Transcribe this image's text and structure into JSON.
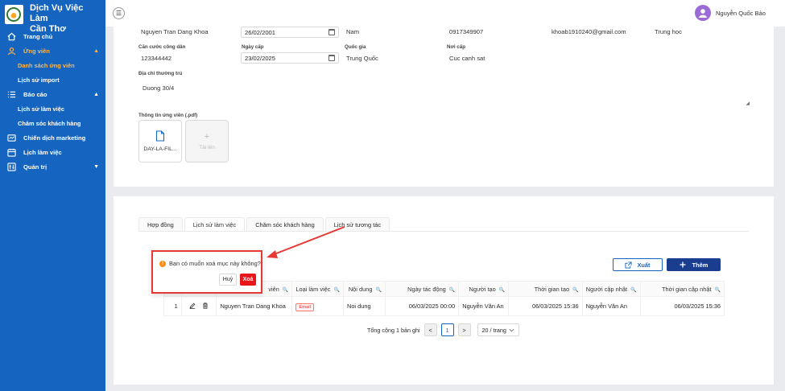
{
  "brand": {
    "title_line1": "Dịch Vụ Việc Làm",
    "title_line2": "Cần Thơ"
  },
  "sidebar": {
    "items": [
      {
        "label": "Trang chủ",
        "icon": "home-icon"
      },
      {
        "label": "Ứng viên",
        "icon": "user-icon",
        "caret": "▲"
      },
      {
        "label": "Danh sách ứng viên"
      },
      {
        "label": "Lịch sử import"
      },
      {
        "label": "Báo cáo",
        "icon": "list-icon",
        "caret": "▲"
      },
      {
        "label": "Lịch sử làm việc"
      },
      {
        "label": "Chăm sóc khách hàng"
      },
      {
        "label": "Chiến dịch marketing",
        "icon": "campaign-icon"
      },
      {
        "label": "Lịch làm việc",
        "icon": "calendar-icon"
      },
      {
        "label": "Quản trị",
        "icon": "admin-icon",
        "caret": "▼"
      }
    ]
  },
  "topbar": {
    "menu_toggle": "☰",
    "user_name": "Nguyễn Quốc Bảo"
  },
  "profile": {
    "full_name": "Nguyen Tran Dang Khoa",
    "dob": "26/02/2001",
    "gender": "Nam",
    "phone": "0917349907",
    "email": "khoab1910240@gmail.com",
    "education": "Trung học",
    "id_label": "Căn cước công dân",
    "id_value": "123344442",
    "issue_date_label": "Ngày cấp",
    "issue_date_value": "23/02/2025",
    "nationality_label": "Quốc gia",
    "nationality_value": "Trung Quốc",
    "issue_place_label": "Nơi cấp",
    "issue_place_value": "Cuc canh sat",
    "address_label": "Địa chỉ thường trú",
    "address_value": "Duong 30/4",
    "files_label": "Thông tin ứng viên (.pdf)",
    "file_name": "DAY-LA-FIL...",
    "upload_plus": "+",
    "upload_label": "Tải lên"
  },
  "tabs": [
    {
      "label": "Hợp đồng"
    },
    {
      "label": "Lịch sử làm việc"
    },
    {
      "label": "Chăm sóc khách hàng"
    },
    {
      "label": "Lịch sử tương tác"
    }
  ],
  "toolbar": {
    "export_label": "Xuất",
    "add_label": "Thêm"
  },
  "table": {
    "headers": [
      "viên",
      "Loại làm việc",
      "Nội dung",
      "Ngày tác động",
      "Người tạo",
      "Thời gian tạo",
      "Người cập nhật",
      "Thời gian cập nhật"
    ],
    "rows": [
      {
        "index": "1",
        "name": "Nguyen Tran Dang Khoa",
        "type": "Email",
        "content": "Noi dung",
        "action_date": "06/03/2025 00:00",
        "creator": "Nguyễn Văn An",
        "created_at": "06/03/2025 15:36",
        "updater": "Nguyễn Văn An",
        "updated_at": "06/03/2025 15:36"
      }
    ]
  },
  "pagination": {
    "total": "Tổng cộng 1 bản ghi",
    "prev": "<",
    "current": "1",
    "next": ">",
    "page_size": "20 / trang"
  },
  "popconfirm": {
    "message": "Bạn có muốn xoá mục này không?",
    "cancel": "Huỷ",
    "ok": "Xoá",
    "warn_glyph": "!"
  },
  "colors": {
    "sidebar": "#1565c0",
    "accent_active": "#ffb74d",
    "danger": "#e8151a",
    "annotation": "#e53935",
    "primary_dark": "#1a3d8f"
  }
}
